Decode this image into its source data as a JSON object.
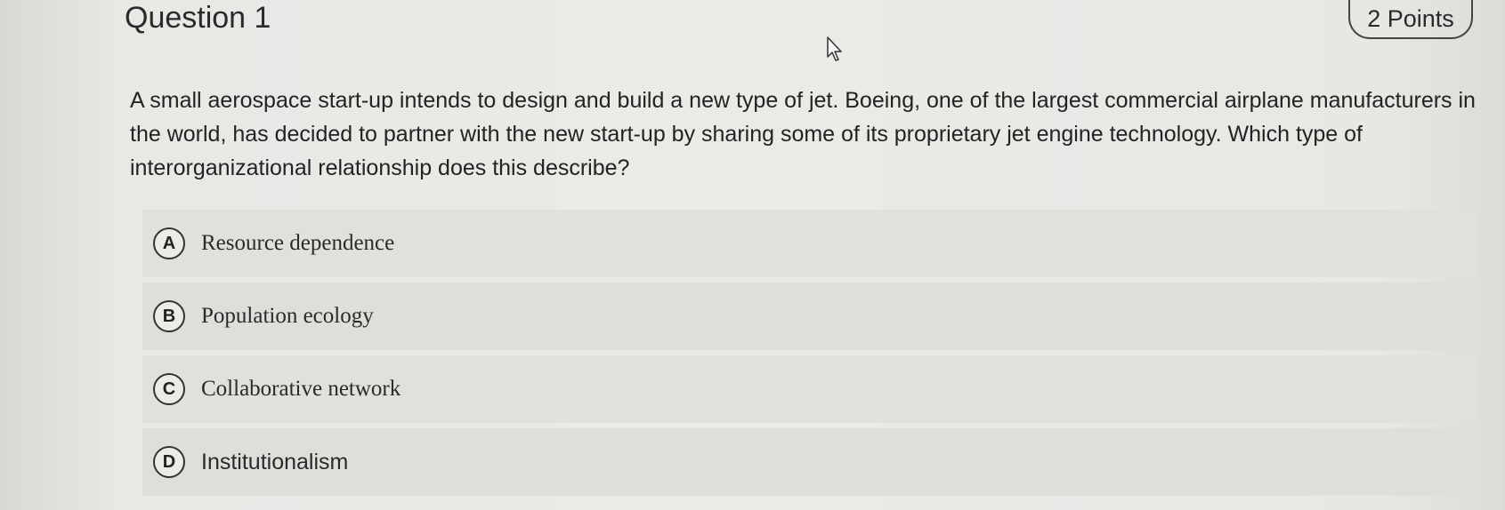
{
  "question": {
    "title": "Question 1",
    "points": "2 Points",
    "text": "A small aerospace start-up intends to design and build a new type of jet. Boeing, one of the largest commercial airplane manufacturers in the world, has decided to partner with the new start-up by sharing some of its proprietary jet engine technology. Which type of interorganizational relationship does this describe?"
  },
  "options": [
    {
      "letter": "A",
      "label": "Resource dependence"
    },
    {
      "letter": "B",
      "label": "Population ecology"
    },
    {
      "letter": "C",
      "label": "Collaborative network"
    },
    {
      "letter": "D",
      "label": "Institutionalism"
    }
  ],
  "icons": {
    "cursor": "mouse-pointer-icon"
  }
}
